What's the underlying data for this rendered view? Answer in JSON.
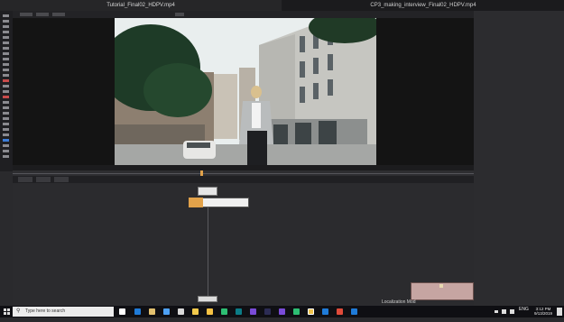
{
  "tabs": [
    {
      "label": "Tutorial_Final02_HDPV.mp4"
    },
    {
      "label": "CP3_making_interview_Final02_HDPV.mp4"
    }
  ],
  "bottom_panel": {
    "localization_label": "Localization Mod"
  },
  "taskbar": {
    "search_placeholder": "Type here to search",
    "language": "ENG",
    "time": "3:12 PM",
    "date": "9/13/2019"
  },
  "colors": {
    "accent_orange": "#e2a24a",
    "node_white": "#f0f0f0",
    "panel_bg": "#2a2a2d"
  }
}
